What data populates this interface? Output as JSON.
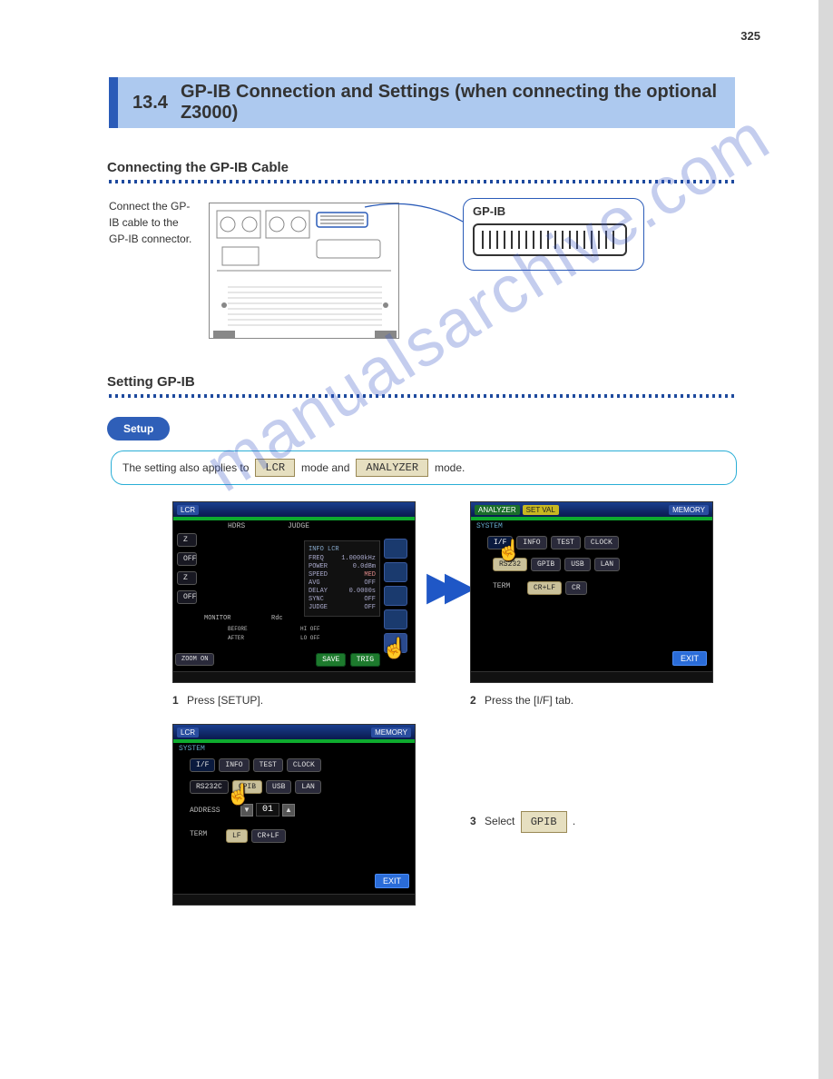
{
  "page_number": "325",
  "section": {
    "number": "13.4",
    "title": "GP-IB Connection and Settings (when connecting the optional Z3000)"
  },
  "sub_connecting": "Connecting the GP-IB Cable",
  "connect_instr": "Connect the GP-IB cable to the GP-IB connector.",
  "gp_label": "GP-IB",
  "sub_setting": "Setting GP-IB",
  "setup_label": "Setup",
  "mode_note_pre": "The setting also applies to ",
  "mode_lcr": "LCR",
  "mode_note_mid": " mode and ",
  "mode_analyzer": "ANALYZER",
  "mode_note_post": " mode.",
  "screenshot_a": {
    "title_left": "LCR",
    "params_z": "Z",
    "params_off": "OFF",
    "zoom": "ZOOM ON",
    "save": "SAVE",
    "trig": "TRIG",
    "info_title": "INFO LCR",
    "info": {
      "freq_l": "FREQ",
      "freq_v": "1.0000kHz",
      "power_l": "POWER",
      "power_v": "0.0dBm",
      "speed_l": "SPEED",
      "speed_v": "MED",
      "avg_l": "AVG",
      "avg_v": "OFF",
      "delay_l": "DELAY",
      "delay_v": "0.0000s",
      "sync_l": "SYNC",
      "sync_v": "OFF",
      "judge_l": "JUDGE",
      "judge_v": "OFF"
    },
    "bot1": "BEFORE",
    "bot2": "AFTER",
    "hdrs": "HDRS",
    "rdc": "Rdc",
    "judge": "JUDGE",
    "hiof": "HI  OFF",
    "loof": "LO  OFF"
  },
  "screenshot_b": {
    "title": "ANALYZER",
    "mode_pill": "SET VAL",
    "memory": "MEMORY",
    "section": "SYSTEM",
    "tabs": [
      "I/F",
      "INFO",
      "TEST",
      "CLOCK"
    ],
    "row1": [
      "RS232",
      "GPIB",
      "USB",
      "LAN"
    ],
    "term_label": "TERM",
    "term_opts": [
      "CR+LF",
      "CR"
    ],
    "exit": "EXIT"
  },
  "screenshot_c": {
    "title": "LCR",
    "memory": "MEMORY",
    "section": "SYSTEM",
    "tabs": [
      "I/F",
      "INFO",
      "TEST",
      "CLOCK"
    ],
    "row1": [
      "RS232C",
      "GPIB",
      "USB",
      "LAN"
    ],
    "addr_label": "ADDRESS",
    "addr_value": "01",
    "term_label": "TERM",
    "term_opts": [
      "LF",
      "CR+LF"
    ],
    "exit": "EXIT"
  },
  "step1": {
    "n": "1",
    "text": "Press [SETUP]."
  },
  "step2": {
    "n": "2",
    "text": "Press the [I/F] tab."
  },
  "step3_a": {
    "n": "3",
    "t1": "Select ",
    "t2": "."
  },
  "gpib_chip": "GPIB",
  "watermark": "manualsarchive.com"
}
